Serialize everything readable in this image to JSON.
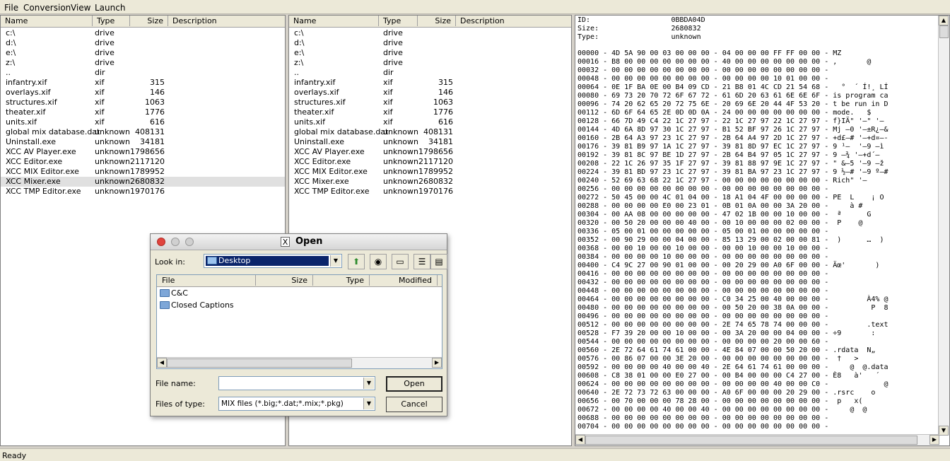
{
  "menu": [
    "File",
    "Conversion",
    "View",
    "Launch"
  ],
  "columns": {
    "name": "Name",
    "type": "Type",
    "size": "Size",
    "description": "Description"
  },
  "left_rows": [
    {
      "name": "c:\\",
      "type": "drive",
      "size": ""
    },
    {
      "name": "d:\\",
      "type": "drive",
      "size": ""
    },
    {
      "name": "e:\\",
      "type": "drive",
      "size": ""
    },
    {
      "name": "z:\\",
      "type": "drive",
      "size": ""
    },
    {
      "name": "..",
      "type": "dir",
      "size": ""
    },
    {
      "name": "infantry.xif",
      "type": "xif",
      "size": "315"
    },
    {
      "name": "overlays.xif",
      "type": "xif",
      "size": "146"
    },
    {
      "name": "structures.xif",
      "type": "xif",
      "size": "1063"
    },
    {
      "name": "theater.xif",
      "type": "xif",
      "size": "1776"
    },
    {
      "name": "units.xif",
      "type": "xif",
      "size": "616"
    },
    {
      "name": "global mix database.dat",
      "type": "unknown",
      "size": "408131"
    },
    {
      "name": "Uninstall.exe",
      "type": "unknown",
      "size": "34181"
    },
    {
      "name": "XCC AV Player.exe",
      "type": "unknown",
      "size": "1798656"
    },
    {
      "name": "XCC Editor.exe",
      "type": "unknown",
      "size": "2117120"
    },
    {
      "name": "XCC MIX Editor.exe",
      "type": "unknown",
      "size": "1789952"
    },
    {
      "name": "XCC Mixer.exe",
      "type": "unknown",
      "size": "2680832"
    },
    {
      "name": "XCC TMP Editor.exe",
      "type": "unknown",
      "size": "1970176"
    }
  ],
  "right_rows": [
    {
      "name": "c:\\",
      "type": "drive",
      "size": ""
    },
    {
      "name": "d:\\",
      "type": "drive",
      "size": ""
    },
    {
      "name": "e:\\",
      "type": "drive",
      "size": ""
    },
    {
      "name": "z:\\",
      "type": "drive",
      "size": ""
    },
    {
      "name": "..",
      "type": "dir",
      "size": ""
    },
    {
      "name": "infantry.xif",
      "type": "xif",
      "size": "315"
    },
    {
      "name": "overlays.xif",
      "type": "xif",
      "size": "146"
    },
    {
      "name": "structures.xif",
      "type": "xif",
      "size": "1063"
    },
    {
      "name": "theater.xif",
      "type": "xif",
      "size": "1776"
    },
    {
      "name": "units.xif",
      "type": "xif",
      "size": "616"
    },
    {
      "name": "global mix database.dat",
      "type": "unknown",
      "size": "408131"
    },
    {
      "name": "Uninstall.exe",
      "type": "unknown",
      "size": "34181"
    },
    {
      "name": "XCC AV Player.exe",
      "type": "unknown",
      "size": "1798656"
    },
    {
      "name": "XCC Editor.exe",
      "type": "unknown",
      "size": "2117120"
    },
    {
      "name": "XCC MIX Editor.exe",
      "type": "unknown",
      "size": "1789952"
    },
    {
      "name": "XCC Mixer.exe",
      "type": "unknown",
      "size": "2680832"
    },
    {
      "name": "XCC TMP Editor.exe",
      "type": "unknown",
      "size": "1970176"
    }
  ],
  "hex": {
    "info": [
      "ID:                   0BBDA04D",
      "Size:                 2680832",
      "Type:                 unknown"
    ],
    "lines": [
      "00000 - 4D 5A 90 00 03 00 00 00 - 04 00 00 00 FF FF 00 00 - MZ",
      "00016 - B8 00 00 00 00 00 00 00 - 40 00 00 00 00 00 00 00 - ,       @",
      "00032 - 00 00 00 00 00 00 00 00 - 00 00 00 00 00 00 00 00 -",
      "00048 - 00 00 00 00 00 00 00 00 - 00 00 00 00 10 01 00 00 -",
      "00064 - 0E 1F BA 0E 00 B4 09 CD - 21 B8 01 4C CD 21 54 68 -   °  ´ Í!¸ LÍ",
      "00080 - 69 73 20 70 72 6F 67 72 - 61 6D 20 63 61 6E 6E 6F - is program ca",
      "00096 - 74 20 62 65 20 72 75 6E - 20 69 6E 20 44 4F 53 20 - t be run in D",
      "00112 - 6D 6F 64 65 2E 0D 0D 0A - 24 00 00 00 00 00 00 00 - mode.   $",
      "00128 - 66 7D 49 C4 22 1C 27 97 - 22 1C 27 97 22 1C 27 97 - f}IÄ\" '—\" '—",
      "00144 - 4D 6A 8D 97 30 1C 27 97 - B1 52 BF 97 26 1C 27 97 - Mj —0 '—±R¿—&",
      "00160 - 2B 64 A3 97 23 1C 27 97 - 2B 64 A4 97 2D 1C 27 97 - +d£—# '—+d¤—-",
      "00176 - 39 81 B9 97 1A 1C 27 97 - 39 81 8D 97 EC 1C 27 97 - 9 ¹—  '—9 —ì",
      "00192 - 39 81 8C 97 BE 1D 27 97 - 2B 64 B4 97 05 1C 27 97 - 9 —¾ '—+d´—",
      "00208 - 22 1C 26 97 35 1F 27 97 - 39 81 88 97 9E 1C 27 97 - \" &—5 '—9 —ž",
      "00224 - 39 81 BD 97 23 1C 27 97 - 39 81 BA 97 23 1C 27 97 - 9 ½—# '—9 º—#",
      "00240 - 52 69 63 68 22 1C 27 97 - 00 00 00 00 00 00 00 00 - Rich\" '—",
      "00256 - 00 00 00 00 00 00 00 00 - 00 00 00 00 00 00 00 00 -",
      "00272 - 50 45 00 00 4C 01 04 00 - 18 A1 04 4F 00 00 00 00 - PE  L    ¡ O",
      "00288 - 00 00 00 00 E0 00 23 01 - 0B 01 0A 00 00 3A 20 00 -     à #",
      "00304 - 00 AA 08 00 00 00 00 00 - 47 02 1B 00 00 10 00 00 -  ª      G",
      "00320 - 00 50 20 00 00 00 40 00 - 00 10 00 00 00 02 00 00 -  P    @",
      "00336 - 05 00 01 00 00 00 00 00 - 05 00 01 00 00 00 00 00 -",
      "00352 - 00 90 29 00 00 04 00 00 - 85 13 29 00 02 00 00 81 -  )      …  )",
      "00368 - 00 00 10 00 00 10 00 00 - 00 00 10 00 00 10 00 00 -",
      "00384 - 00 00 00 00 10 00 00 00 - 00 00 00 00 00 00 00 00 -",
      "00400 - C4 9C 27 00 90 01 00 00 - 00 20 29 00 A0 6F 00 00 - Äœ'       )",
      "00416 - 00 00 00 00 00 00 00 00 - 00 00 00 00 00 00 00 00 -",
      "00432 - 00 00 00 00 00 00 00 00 - 00 00 00 00 00 00 00 00 -",
      "00448 - 00 00 00 00 00 00 00 00 - 00 00 00 00 00 00 00 00 -",
      "00464 - 00 00 00 00 00 00 00 00 - C0 34 25 00 40 00 00 00 -         À4% @",
      "00480 - 00 00 00 00 00 00 00 00 - 00 50 20 00 38 0A 00 00 -          P  8",
      "00496 - 00 00 00 00 00 00 00 00 - 00 00 00 00 00 00 00 00 -",
      "00512 - 00 00 00 00 00 00 00 00 - 2E 74 65 78 74 00 00 00 -         .text",
      "00528 - F7 39 20 00 00 10 00 00 - 00 3A 20 00 00 04 00 00 - ÷9       :",
      "00544 - 00 00 00 00 00 00 00 00 - 00 00 00 00 20 00 00 60 -",
      "00560 - 2E 72 64 61 74 61 00 00 - 4E 84 07 00 00 50 20 00 - .rdata  N„",
      "00576 - 00 86 07 00 00 3E 20 00 - 00 00 00 00 00 00 00 00 -  †   >",
      "00592 - 00 00 00 00 40 00 00 40 - 2E 64 61 74 61 00 00 00 -     @  @.data",
      "00608 - C8 38 01 00 00 E0 27 00 - 00 B4 00 00 00 C4 27 00 - È8   à'   ´",
      "00624 - 00 00 00 00 00 00 00 00 - 00 00 00 00 40 00 00 C0 -             @",
      "00640 - 2E 72 73 72 63 00 00 00 - A0 6F 00 00 00 20 29 00 - .rsrc    o",
      "00656 - 00 70 00 00 00 78 28 00 - 00 00 00 00 00 00 00 00 -  p   x(",
      "00672 - 00 00 00 00 40 00 00 40 - 00 00 00 00 00 00 00 00 -     @  @",
      "00688 - 00 00 00 00 00 00 00 00 - 00 00 00 00 00 00 00 00 -",
      "00704 - 00 00 00 00 00 00 00 00 - 00 00 00 00 00 00 00 00 -"
    ]
  },
  "status": "Ready",
  "dialog": {
    "title": "Open",
    "look_in_label": "Look in:",
    "look_in_value": "Desktop",
    "list_columns": {
      "file": "File",
      "size": "Size",
      "type": "Type",
      "modified": "Modified"
    },
    "items": [
      "C&C",
      "Closed Captions"
    ],
    "file_name_label": "File name:",
    "file_name_value": "",
    "files_of_type_label": "Files of type:",
    "files_of_type_value": "MIX files (*.big;*.dat;*.mix;*.pkg)",
    "open_button": "Open",
    "cancel_button": "Cancel"
  }
}
